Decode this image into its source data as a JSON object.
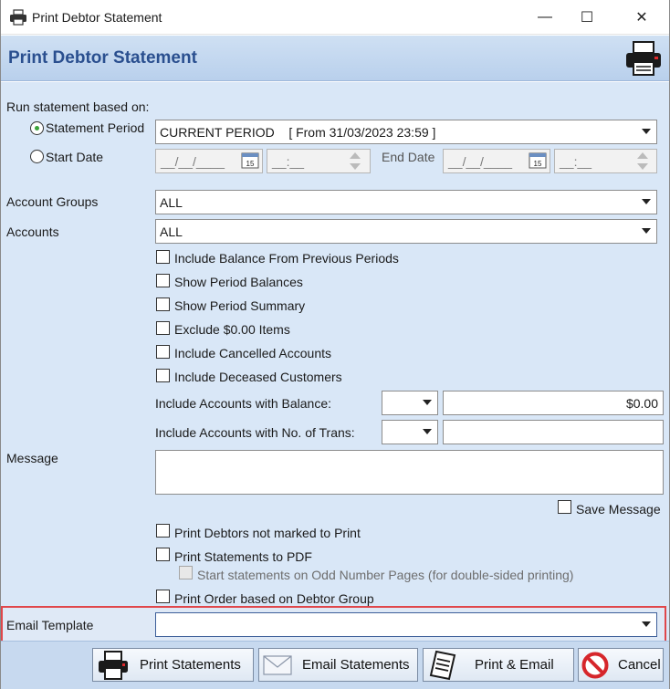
{
  "window": {
    "title": "Print Debtor Statement",
    "minimize": "—",
    "maximize": "☐",
    "close": "✕"
  },
  "header": {
    "title": "Print Debtor Statement"
  },
  "run_based_on": {
    "label": "Run statement based on:",
    "statement_period_label": "Statement Period",
    "statement_period_selected": true,
    "statement_period_value": "CURRENT PERIOD    [ From 31/03/2023 23:59 ]",
    "start_date_label": "Start Date",
    "start_date_value": "__/__/____",
    "start_time_value": "__:__",
    "end_date_label": "End Date",
    "end_date_value": "__/__/____",
    "end_time_value": "__:__",
    "calendar_day": "15"
  },
  "filters": {
    "account_groups_label": "Account Groups",
    "account_groups_value": "ALL",
    "accounts_label": "Accounts",
    "accounts_value": "ALL"
  },
  "options": [
    {
      "label": "Include Balance From Previous Periods",
      "checked": false
    },
    {
      "label": "Show Period Balances",
      "checked": false
    },
    {
      "label": "Show Period Summary",
      "checked": false
    },
    {
      "label": "Exclude $0.00 Items",
      "checked": false
    },
    {
      "label": "Include Cancelled Accounts",
      "checked": false
    },
    {
      "label": "Include Deceased Customers",
      "checked": false
    }
  ],
  "balance_filter": {
    "label": "Include Accounts with Balance:",
    "operator": "",
    "value": "$0.00"
  },
  "trans_filter": {
    "label": "Include Accounts with No. of Trans:",
    "operator": "",
    "value": ""
  },
  "message": {
    "label": "Message",
    "value": "",
    "save_label": "Save Message"
  },
  "print_options": {
    "not_marked_label": "Print Debtors not marked to Print",
    "to_pdf_label": "Print Statements to PDF",
    "odd_pages_label": "Start statements on Odd Number Pages (for double-sided printing)",
    "order_group_label": "Print Order based on Debtor Group"
  },
  "email_template": {
    "label": "Email Template",
    "value": ""
  },
  "buttons": {
    "print_statements": "Print Statements",
    "email_statements": "Email Statements",
    "print_email": "Print & Email",
    "cancel": "Cancel"
  },
  "colors": {
    "header_title": "#2a4f8f",
    "highlight_border": "#e0474b",
    "cancel_red": "#d6262b"
  }
}
